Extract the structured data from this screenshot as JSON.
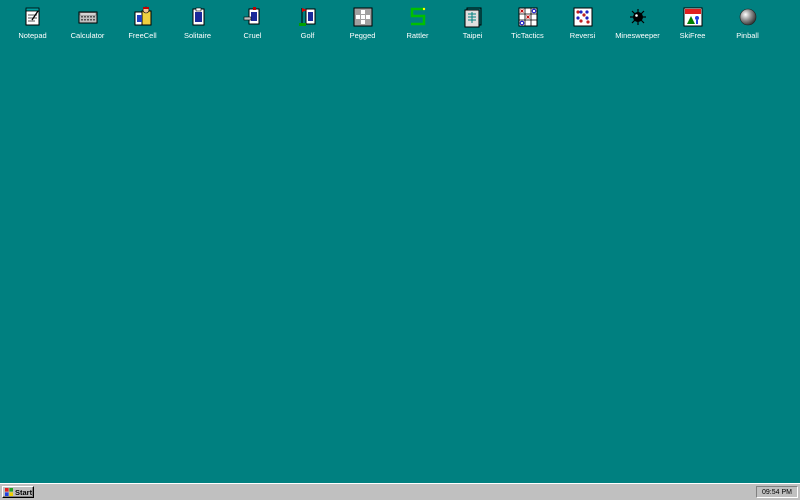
{
  "desktop": {
    "background_color": "#008080",
    "icons": [
      {
        "label": "Notepad",
        "icon": "notepad-icon"
      },
      {
        "label": "Calculator",
        "icon": "calculator-icon"
      },
      {
        "label": "FreeCell",
        "icon": "freecell-icon"
      },
      {
        "label": "Solitaire",
        "icon": "solitaire-icon"
      },
      {
        "label": "Cruel",
        "icon": "cruel-icon"
      },
      {
        "label": "Golf",
        "icon": "golf-icon"
      },
      {
        "label": "Pegged",
        "icon": "pegged-icon"
      },
      {
        "label": "Rattler",
        "icon": "rattler-icon"
      },
      {
        "label": "Taipei",
        "icon": "taipei-icon"
      },
      {
        "label": "TicTactics",
        "icon": "tictactics-icon"
      },
      {
        "label": "Reversi",
        "icon": "reversi-icon"
      },
      {
        "label": "Minesweeper",
        "icon": "minesweeper-icon"
      },
      {
        "label": "SkiFree",
        "icon": "skifree-icon"
      },
      {
        "label": "Pinball",
        "icon": "pinball-icon"
      }
    ]
  },
  "taskbar": {
    "start_label": "Start",
    "clock": "09:54 PM",
    "color": "#c0c0c0"
  }
}
